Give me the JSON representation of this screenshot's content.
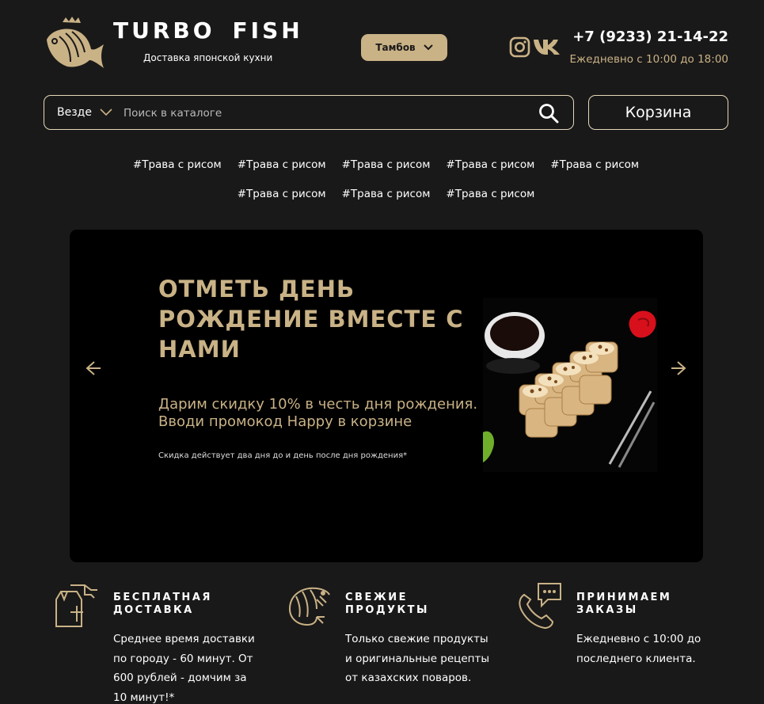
{
  "header": {
    "brand_left": "TURBO",
    "brand_right": "FISH",
    "tagline": "Доставка японской кухни",
    "city": "Тамбов",
    "phone": "+7 (9233) 21-14-22",
    "hours": "Ежедневно с 10:00 до 18:00",
    "social_icons": [
      "instagram-icon",
      "vk-icon"
    ]
  },
  "search": {
    "scope": "Везде",
    "placeholder": "Поиск в каталоге",
    "value": ""
  },
  "cart_label": "Корзина",
  "tags": [
    "#Трава с рисом",
    "#Трава с рисом",
    "#Трава с рисом",
    "#Трава с рисом",
    "#Трава с рисом",
    "#Трава с рисом",
    "#Трава с рисом",
    "#Трава с рисом"
  ],
  "banner": {
    "title": "ОТМЕТЬ ДЕНЬ РОЖДЕНИЕ ВМЕСТЕ С НАМИ",
    "text": "Дарим скидку 10% в честь дня рождения. Вводи промокод Happy в корзине",
    "note": "Скидка действует два дня до и день после дня рождения*"
  },
  "features": [
    {
      "icon": "delivery-bag-icon",
      "title": "БЕСПЛАТНАЯ ДОСТАВКА",
      "body": "Среднее время доставки по городу - 60 минут. От 600 рублей - домчим за 10 минут!*"
    },
    {
      "icon": "shrimp-icon",
      "title": "СВЕЖИЕ ПРОДУКТЫ",
      "body": "Только свежие продукты и оригинальные рецепты от казахских поваров."
    },
    {
      "icon": "phone-chat-icon",
      "title": "ПРИНИМАЕМ ЗАКАЗЫ",
      "body": "Ежедневно с 10:00 до последнего клиента."
    }
  ],
  "colors": {
    "background": "#1a1919",
    "accent": "#c9b286",
    "banner": "#000000"
  }
}
